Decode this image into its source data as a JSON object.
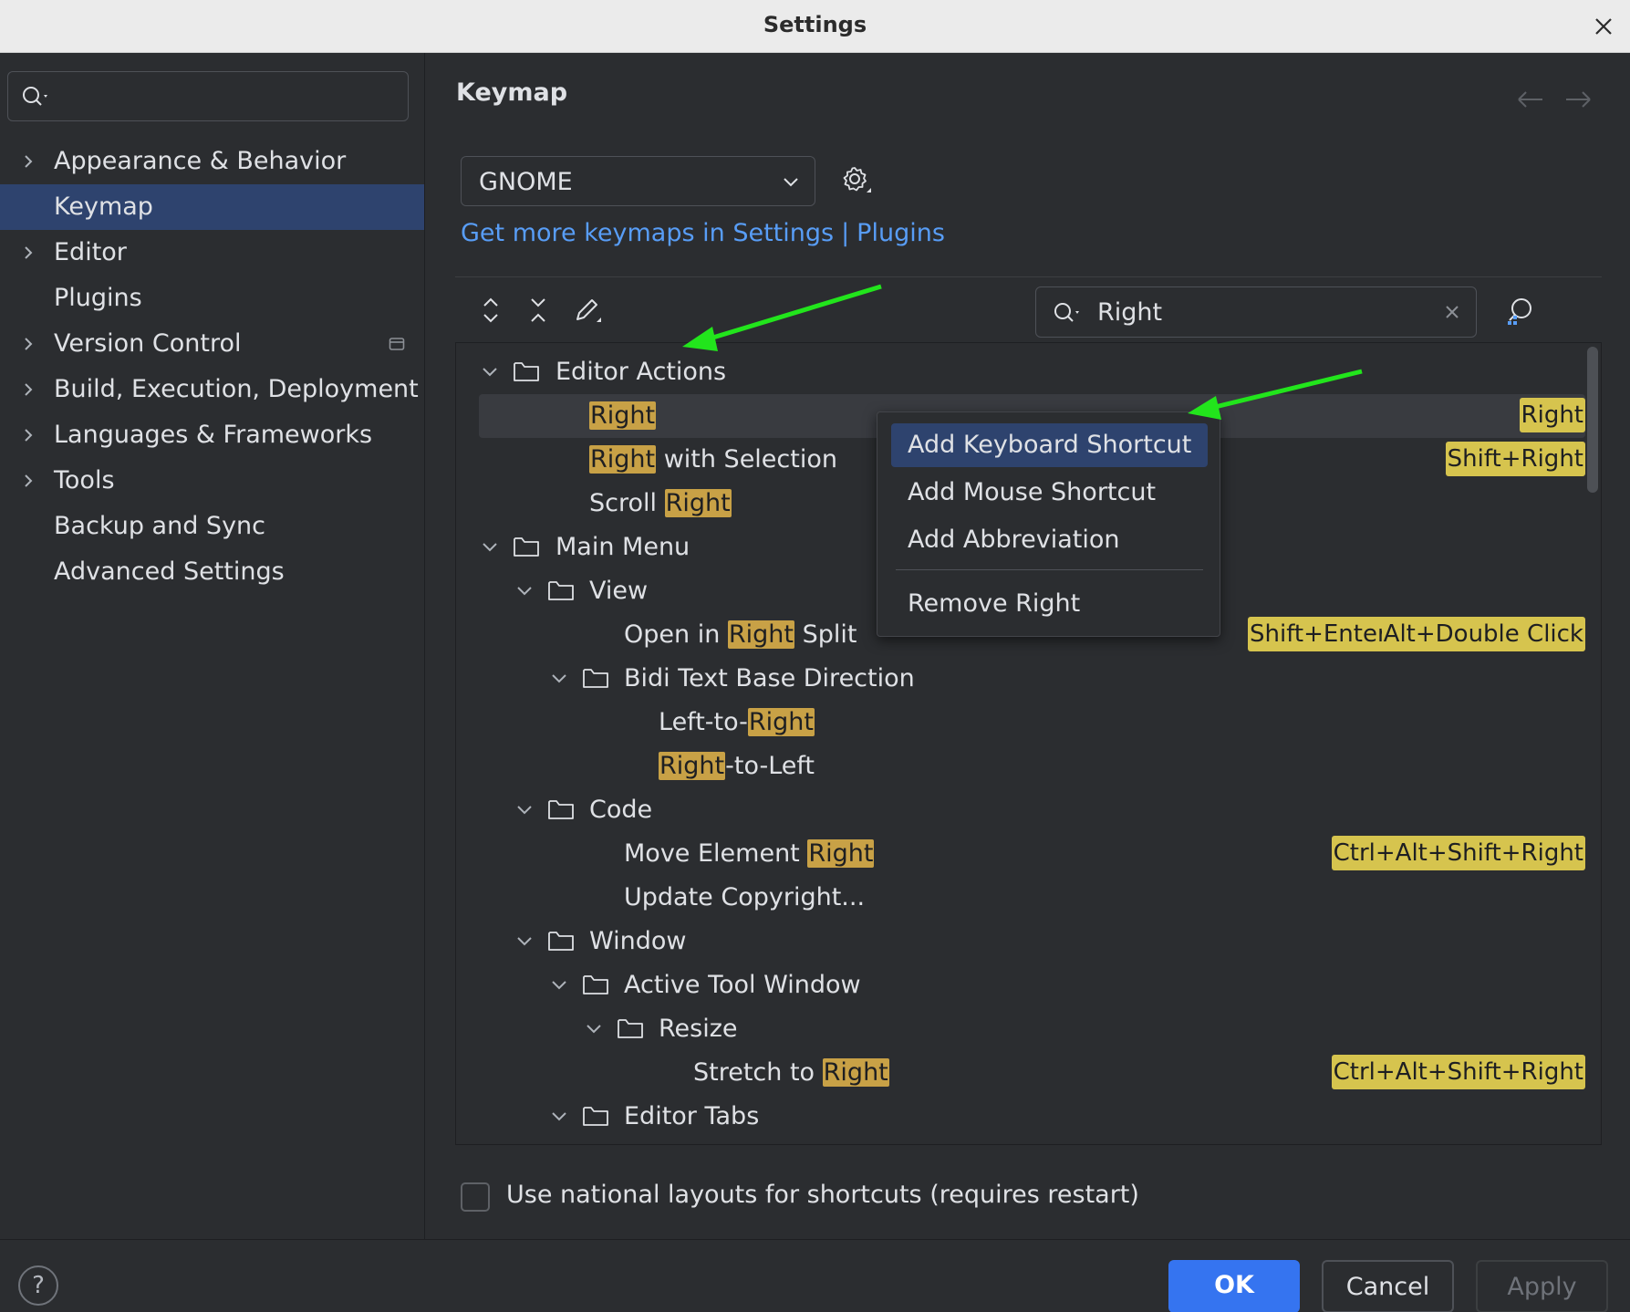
{
  "window": {
    "title": "Settings"
  },
  "sidebar": {
    "search_placeholder": "",
    "items": [
      {
        "label": "Appearance & Behavior",
        "expandable": true
      },
      {
        "label": "Keymap",
        "expandable": false,
        "selected": true
      },
      {
        "label": "Editor",
        "expandable": true
      },
      {
        "label": "Plugins",
        "expandable": false
      },
      {
        "label": "Version Control",
        "expandable": true
      },
      {
        "label": "Build, Execution, Deployment",
        "expandable": true
      },
      {
        "label": "Languages & Frameworks",
        "expandable": true
      },
      {
        "label": "Tools",
        "expandable": true
      },
      {
        "label": "Backup and Sync",
        "expandable": false
      },
      {
        "label": "Advanced Settings",
        "expandable": false
      }
    ]
  },
  "main": {
    "title": "Keymap",
    "keymap_scheme": "GNOME",
    "link_prefix": "Get more keymaps in Settings",
    "link_separator": "|",
    "link_plugins": "Plugins",
    "search_value": "Right",
    "tree": {
      "editor_actions": "Editor Actions",
      "right": "Right",
      "right_sc": "Right",
      "with_selection": " with Selection",
      "with_selection_sc": "Shift+Right",
      "scroll": "Scroll ",
      "main_menu": "Main Menu",
      "view": "View",
      "open_in": "Open in ",
      "split": " Split",
      "open_sc1": "Shift+Enter",
      "open_sc2": "Alt+Double Click",
      "bidi": "Bidi Text Base Direction",
      "ltr_prefix": "Left-to-",
      "rtl_suffix": "-to-Left",
      "code": "Code",
      "move_element": "Move Element ",
      "move_sc": "Ctrl+Alt+Shift+Right",
      "update_copyright": "Update Copyright...",
      "window": "Window",
      "active_tool_window": "Active Tool Window",
      "resize": "Resize",
      "stretch_to": "Stretch to ",
      "stretch_sc": "Ctrl+Alt+Shift+Right",
      "editor_tabs": "Editor Tabs"
    },
    "context_menu": {
      "items": [
        "Add Keyboard Shortcut",
        "Add Mouse Shortcut",
        "Add Abbreviation",
        "Remove Right"
      ]
    },
    "national_layouts_label": "Use national layouts for shortcuts (requires restart)",
    "national_layouts_checked": false
  },
  "footer": {
    "help": "?",
    "ok": "OK",
    "cancel": "Cancel",
    "apply": "Apply"
  },
  "colors": {
    "accent": "#3574f0",
    "selection": "#2e436e",
    "highlight": "#c8a146",
    "shortcut": "#d6c44e",
    "annotation_arrow": "#22e51c"
  }
}
